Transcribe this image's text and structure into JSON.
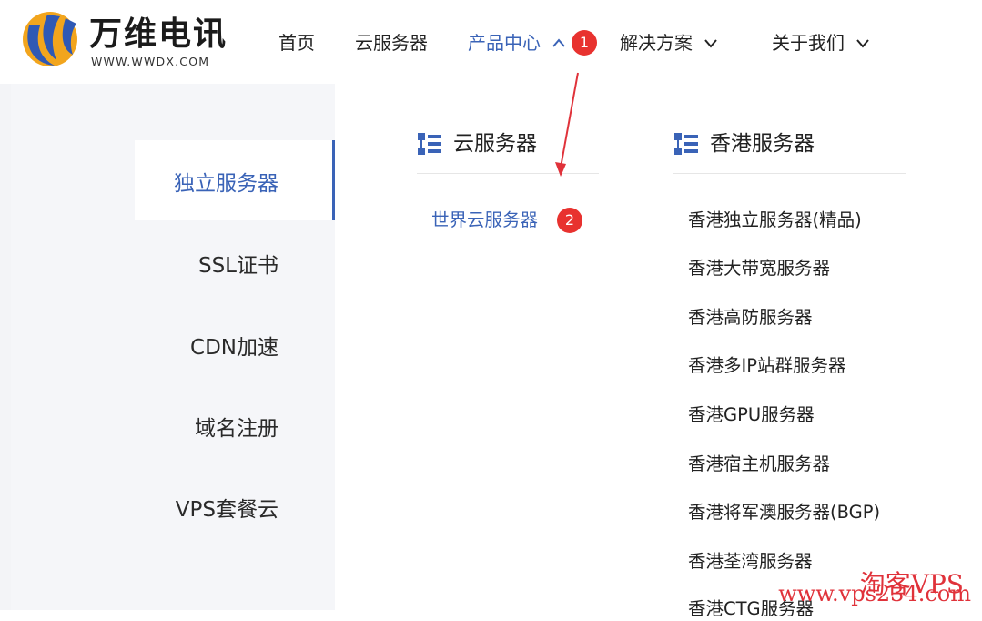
{
  "brand": {
    "name": "万维电讯",
    "url": "WWW.WWDX.COM"
  },
  "nav": {
    "items": [
      {
        "label": "首页"
      },
      {
        "label": "云服务器"
      },
      {
        "label": "产品中心"
      },
      {
        "label": "解决方案"
      },
      {
        "label": "关于我们"
      }
    ],
    "active_index": 2
  },
  "badges": {
    "first": "1",
    "second": "2"
  },
  "sidebar": {
    "items": [
      {
        "label": "独立服务器"
      },
      {
        "label": "SSL证书"
      },
      {
        "label": "CDN加速"
      },
      {
        "label": "域名注册"
      },
      {
        "label": "VPS套餐云"
      }
    ],
    "active_index": 0
  },
  "columns": [
    {
      "title": "云服务器",
      "links": [
        {
          "label": "世界云服务器"
        }
      ]
    },
    {
      "title": "香港服务器",
      "links": [
        {
          "label": "香港独立服务器(精品)"
        },
        {
          "label": "香港大带宽服务器"
        },
        {
          "label": "香港高防服务器"
        },
        {
          "label": "香港多IP站群服务器"
        },
        {
          "label": "香港GPU服务器"
        },
        {
          "label": "香港宿主机服务器"
        },
        {
          "label": "香港将军澳服务器(BGP)"
        },
        {
          "label": "香港荃湾服务器"
        },
        {
          "label": "香港CTG服务器"
        }
      ]
    }
  ],
  "watermark": {
    "line1": "淘客VPS",
    "line2": "www.vps234.com"
  },
  "colors": {
    "accent": "#3a63b7",
    "badge": "#e8322f",
    "panel_bg": "#f3f4f7"
  }
}
